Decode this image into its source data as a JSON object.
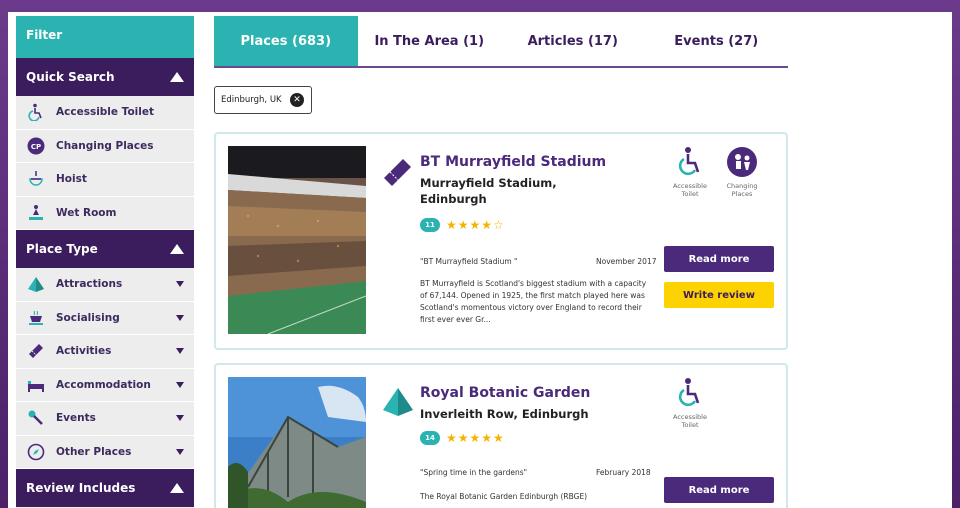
{
  "colors": {
    "teal": "#2bb3b1",
    "purple_dark": "#3b1d5e",
    "purple": "#4b2a7b",
    "yellow": "#fcd200",
    "star": "#f3b400"
  },
  "sidebar": {
    "filter_label": "Filter",
    "quick_search": {
      "title": "Quick Search",
      "items": [
        {
          "label": "Accessible Toilet",
          "icon": "accessible-toilet-icon"
        },
        {
          "label": "Changing Places",
          "icon": "changing-places-icon"
        },
        {
          "label": "Hoist",
          "icon": "hoist-icon"
        },
        {
          "label": "Wet Room",
          "icon": "wet-room-icon"
        }
      ]
    },
    "place_type": {
      "title": "Place Type",
      "items": [
        {
          "label": "Attractions",
          "icon": "pyramid-icon"
        },
        {
          "label": "Socialising",
          "icon": "cup-icon"
        },
        {
          "label": "Activities",
          "icon": "ticket-icon"
        },
        {
          "label": "Accommodation",
          "icon": "bed-icon"
        },
        {
          "label": "Events",
          "icon": "microphone-icon"
        },
        {
          "label": "Other Places",
          "icon": "compass-icon"
        }
      ]
    },
    "review_includes": {
      "title": "Review Includes"
    }
  },
  "tabs": [
    {
      "label": "Places (683)",
      "active": true
    },
    {
      "label": "In The Area (1)",
      "active": false
    },
    {
      "label": "Articles (17)",
      "active": false
    },
    {
      "label": "Events (27)",
      "active": false
    }
  ],
  "filter_chip": {
    "label": "Edinburgh, UK"
  },
  "results": [
    {
      "title": "BT Murrayfield Stadium",
      "address": "Murrayfield Stadium, Edinburgh",
      "review_count": "11",
      "rating": 4,
      "stars": "★★★★☆",
      "quote": "\"BT Murrayfield Stadium \"",
      "date": "November 2017",
      "description": "BT Murrayfield is Scotland's biggest stadium with a capacity of 67,144. Opened in 1925, the first match played here was Scotland's momentous victory over England to record their first ever ever Gr...",
      "read_more": "Read more",
      "write_review": "Write review",
      "amenities": [
        {
          "label": "Accessible Toilet",
          "icon": "accessible-toilet-icon"
        },
        {
          "label": "Changing Places",
          "icon": "changing-places-icon"
        }
      ]
    },
    {
      "title": "Royal Botanic Garden",
      "address": "Inverleith Row, Edinburgh",
      "review_count": "14",
      "rating": 4.5,
      "stars": "★★★★★",
      "quote": "\"Spring time in the gardens\"",
      "date": "February 2018",
      "description": "The Royal Botanic Garden Edinburgh (RBGE)",
      "read_more": "Read more",
      "amenities": [
        {
          "label": "Accessible Toilet",
          "icon": "accessible-toilet-icon"
        }
      ]
    }
  ]
}
